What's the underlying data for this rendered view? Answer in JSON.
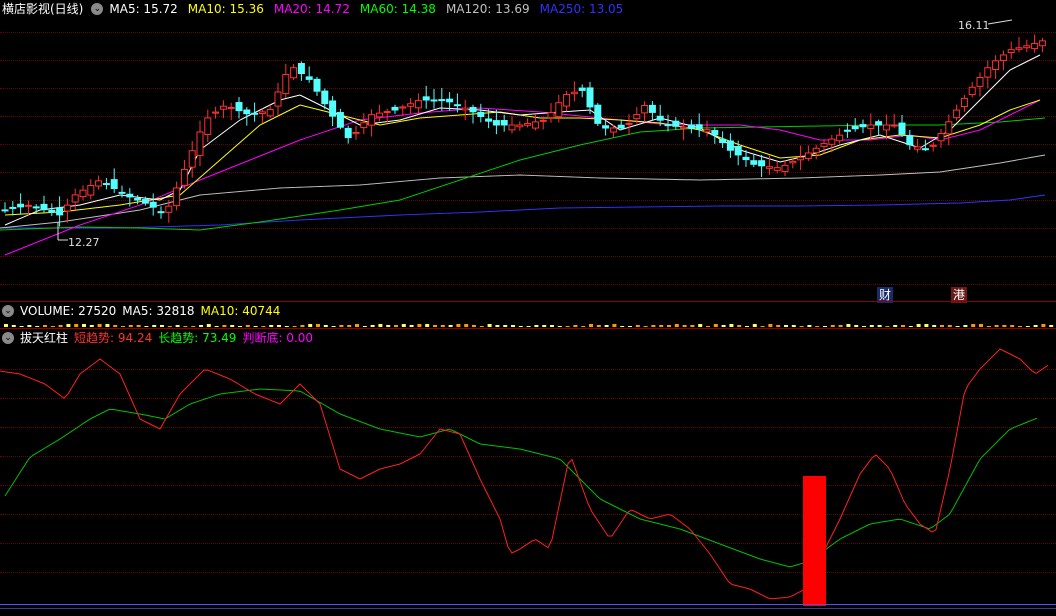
{
  "main_legend": {
    "title": "横店影视(日线)",
    "items": [
      {
        "label": "MA5: 15.72",
        "color": "#ffffff"
      },
      {
        "label": "MA10: 15.36",
        "color": "#ffff00"
      },
      {
        "label": "MA20: 14.72",
        "color": "#ff00ff"
      },
      {
        "label": "MA60: 14.38",
        "color": "#00ff00"
      },
      {
        "label": "MA120: 13.69",
        "color": "#c0c0c0"
      },
      {
        "label": "MA250: 13.05",
        "color": "#3030ff"
      }
    ]
  },
  "annotations": {
    "high": "16.11",
    "low": "12.27",
    "badge_cai": "财",
    "badge_gang": "港"
  },
  "volume_legend": {
    "title": "VOLUME: 27520",
    "ma5": "MA5: 32818",
    "ma10": "MA10: 40744"
  },
  "indicator_legend": {
    "title": "拔天红柱",
    "short": "短趋势: 94.24",
    "long": "长趋势: 73.49",
    "bottom": "判断底: 0.00"
  },
  "colors": {
    "up": "#ff3232",
    "down": "#54ffff",
    "short_trend": "#ff0000",
    "long_trend": "#00c000",
    "separator": "#8b0000"
  }
}
